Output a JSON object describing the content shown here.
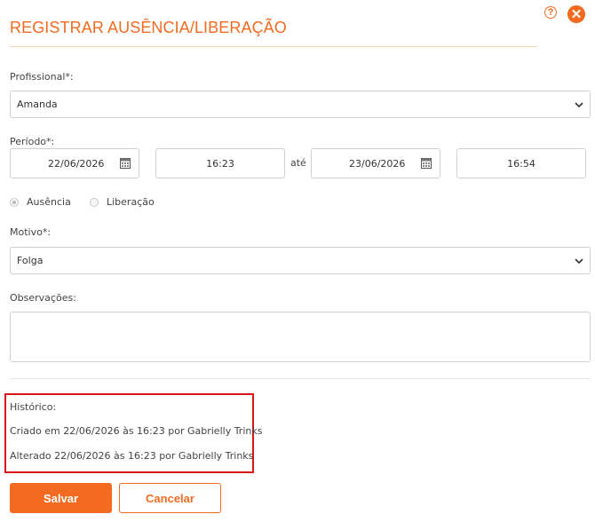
{
  "header": {
    "title": "REGISTRAR AUSÊNCIA/LIBERAÇÃO",
    "help_symbol": "?",
    "close_symbol": "✕"
  },
  "professional": {
    "label": "Profissional*:",
    "value": "Amanda"
  },
  "period": {
    "label": "Período*:",
    "start_date": "22/06/2026",
    "start_time": "16:23",
    "separator": "até",
    "end_date": "23/06/2026",
    "end_time": "16:54"
  },
  "type": {
    "options": [
      {
        "label": "Ausência",
        "selected": true
      },
      {
        "label": "Liberação",
        "selected": false
      }
    ]
  },
  "reason": {
    "label": "Motivo*:",
    "value": "Folga"
  },
  "notes": {
    "label": "Observações:",
    "value": ""
  },
  "history": {
    "label": "Histórico:",
    "created": "Criado em 22/06/2026 às 16:23 por Gabrielly Trinks",
    "altered": "Alterado 22/06/2026 às 16:23 por Gabrielly Trinks"
  },
  "actions": {
    "save_label": "Salvar",
    "cancel_label": "Cancelar"
  },
  "colors": {
    "accent": "#f26b21",
    "highlight_box": "#d9151b"
  }
}
